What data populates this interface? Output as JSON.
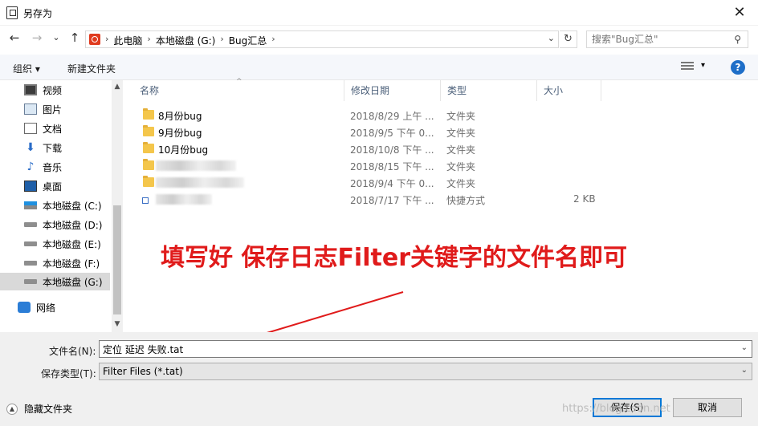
{
  "window": {
    "title": "另存为",
    "close_glyph": "✕"
  },
  "nav": {
    "back_glyph": "←",
    "forward_glyph": "→",
    "recent_glyph": "⌄",
    "up_glyph": "↑",
    "breadcrumbs": [
      "此电脑",
      "本地磁盘 (G:)",
      "Bug汇总"
    ],
    "crumb_sep": "›",
    "dropdown_glyph": "⌄",
    "refresh_glyph": "↻",
    "search_placeholder": "搜索\"Bug汇总\"",
    "search_glyph": "⚲"
  },
  "toolbar": {
    "organize_label": "组织 ▾",
    "new_folder_label": "新建文件夹",
    "view_dropdown_glyph": "▾",
    "help_label": "?"
  },
  "sidebar": {
    "items": [
      {
        "label": "视频",
        "icon": "video-icon"
      },
      {
        "label": "图片",
        "icon": "pictures-icon"
      },
      {
        "label": "文档",
        "icon": "documents-icon"
      },
      {
        "label": "下载",
        "icon": "download-icon"
      },
      {
        "label": "音乐",
        "icon": "music-icon"
      },
      {
        "label": "桌面",
        "icon": "desktop-icon"
      },
      {
        "label": "本地磁盘 (C:)",
        "icon": "windows-drive-icon"
      },
      {
        "label": "本地磁盘 (D:)",
        "icon": "drive-icon"
      },
      {
        "label": "本地磁盘 (E:)",
        "icon": "drive-icon"
      },
      {
        "label": "本地磁盘 (F:)",
        "icon": "drive-icon"
      },
      {
        "label": "本地磁盘 (G:)",
        "icon": "drive-icon",
        "selected": true
      },
      {
        "label": "网络",
        "icon": "network-icon"
      }
    ],
    "scroll_up_glyph": "▲",
    "scroll_down_glyph": "▼"
  },
  "filelist": {
    "columns": [
      "名称",
      "修改日期",
      "类型",
      "大小"
    ],
    "sort_glyph": "^",
    "rows": [
      {
        "name": "8月份bug",
        "date": "2018/8/29 上午 ...",
        "type": "文件夹",
        "size": ""
      },
      {
        "name": "9月份bug",
        "date": "2018/9/5 下午 0...",
        "type": "文件夹",
        "size": ""
      },
      {
        "name": "10月份bug",
        "date": "2018/10/8 下午 ...",
        "type": "文件夹",
        "size": ""
      },
      {
        "name": "",
        "date": "2018/8/15 下午 ...",
        "type": "文件夹",
        "size": "",
        "blurred": true
      },
      {
        "name": "",
        "date": "2018/9/4 下午 0...",
        "type": "文件夹",
        "size": "",
        "blurred": true
      },
      {
        "name": "",
        "date": "2018/7/17 下午 ...",
        "type": "快捷方式",
        "size": "2 KB",
        "blurred": true,
        "shortcut": true
      }
    ]
  },
  "annotation": {
    "text": "填写好  保存日志Filter关键字的文件名即可",
    "color": "#e01b1b"
  },
  "form": {
    "filename_label": "文件名(N):",
    "filename_value": "定位 延迟 失败.tat",
    "filetype_label": "保存类型(T):",
    "filetype_value": "Filter Files (*.tat)",
    "dropdown_glyph": "⌄"
  },
  "footer": {
    "hide_folders_label": "隐藏文件夹",
    "hide_folders_glyph": "▲",
    "save_label": "保存(S)",
    "cancel_label": "取消",
    "watermark": "https://blog.csdn.net"
  },
  "colors": {
    "accent": "#0078d7",
    "folder": "#f4c64b",
    "help": "#1e6ec8",
    "annotation": "#e01b1b"
  }
}
